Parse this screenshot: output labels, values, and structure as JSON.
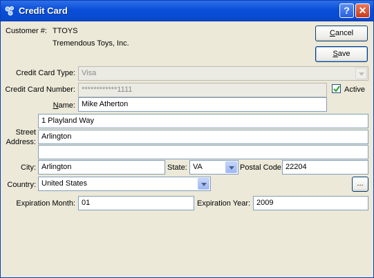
{
  "window": {
    "title": "Credit Card",
    "help_label": "?",
    "close_label": "✕"
  },
  "customer": {
    "label": "Customer #:",
    "number": "TTOYS",
    "name": "Tremendous Toys, Inc."
  },
  "buttons": {
    "cancel": {
      "label": "Cancel",
      "accel": "C",
      "rest": "ancel"
    },
    "save": {
      "label": "Save",
      "accel": "S",
      "rest": "ave"
    },
    "more": {
      "label": "..."
    }
  },
  "form": {
    "cc_type": {
      "label": "Credit Card Type:",
      "value": "Visa"
    },
    "cc_number": {
      "label": "Credit Card Number:",
      "value": "************1111"
    },
    "active": {
      "label": "Active",
      "checked": true
    },
    "name": {
      "label": "Name:",
      "accel": "N",
      "rest": "ame:",
      "value": "Mike Atherton"
    },
    "street_address": {
      "label_line1": "Street",
      "label_line2": "Address:",
      "line1": "1 Playland Way",
      "line2": "Arlington",
      "line3": ""
    },
    "city": {
      "label": "City:",
      "value": "Arlington"
    },
    "state": {
      "label": "State:",
      "value": "VA"
    },
    "postal_code": {
      "label": "Postal Code:",
      "value": "22204"
    },
    "country": {
      "label": "Country:",
      "value": "United States"
    },
    "expiration_month": {
      "label": "Expiration Month:",
      "value": "01"
    },
    "expiration_year": {
      "label": "Expiration Year:",
      "value": "2009"
    }
  }
}
